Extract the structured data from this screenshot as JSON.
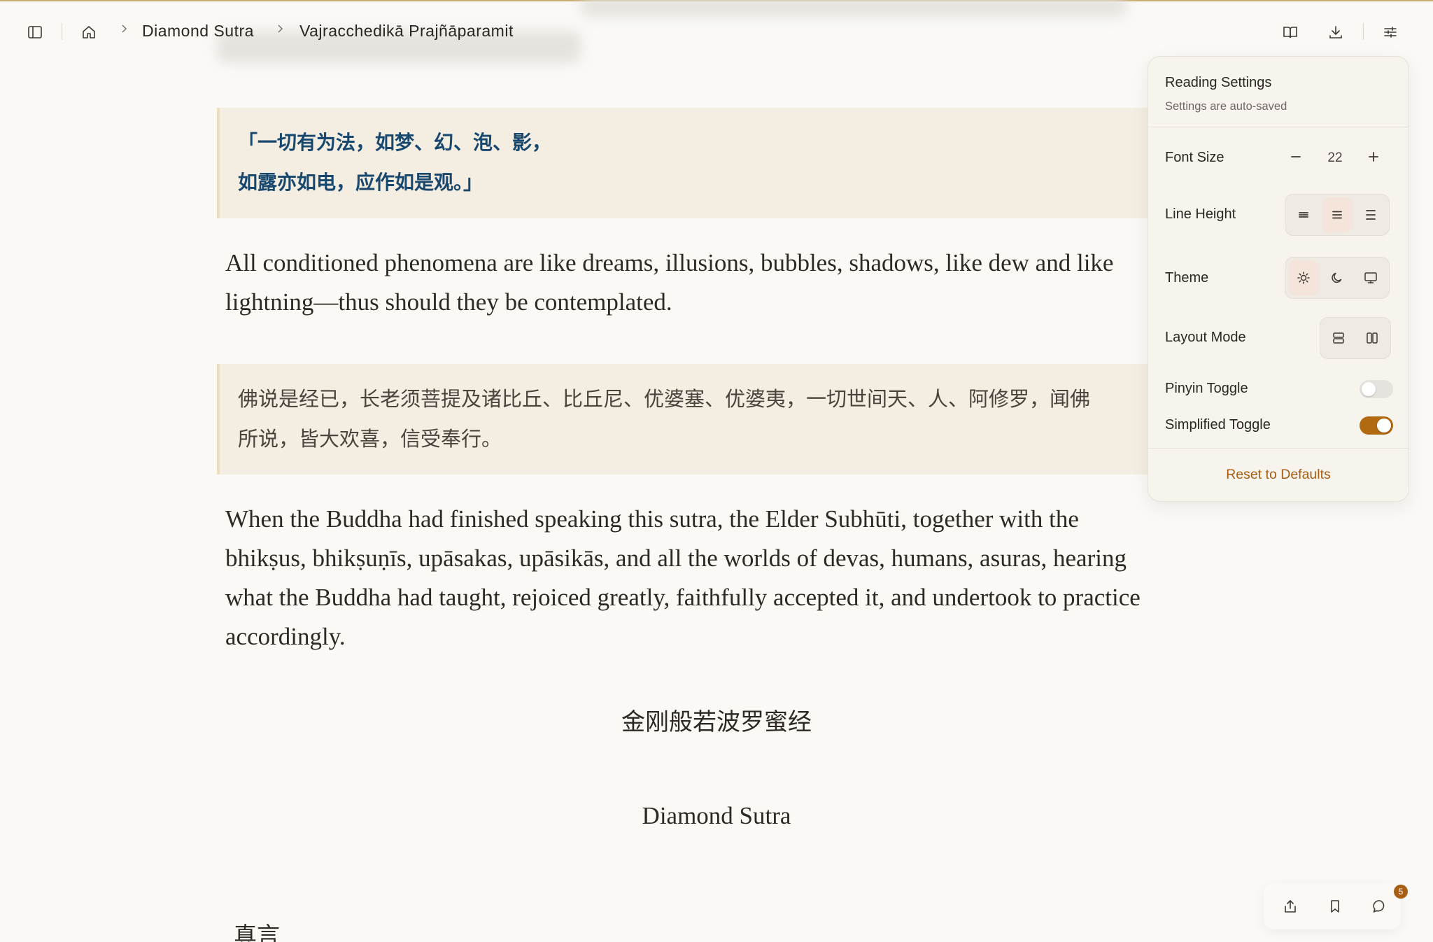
{
  "header": {
    "breadcrumb": [
      "Diamond Sutra",
      "Vajracchedikā Prajñāparamit"
    ]
  },
  "content": {
    "verse_lines": [
      "「一切有为法，如梦、幻、泡、影，",
      "如露亦如电，应作如是观。」"
    ],
    "verse_translation_lines": [
      "All conditioned phenomena are like dreams, illusions, bubbles, shadows, like dew and like",
      "lightning—thus should they be contemplated."
    ],
    "closing_cn_lines": [
      "佛说是经已，长老须菩提及诸比丘、比丘尼、优婆塞、优婆夷，一切世间天、人、阿修罗，闻佛",
      "所说，皆大欢喜，信受奉行。"
    ],
    "closing_en_lines": [
      "When the Buddha had finished speaking this sutra, the Elder Subhūti, together with the",
      "bhikṣus, bhikṣuṇīs, upāsakas, upāsikās, and all the worlds of devas, humans, asuras, hearing",
      "what the Buddha had taught, rejoiced greatly, faithfully accepted it, and undertook to practice",
      "accordingly."
    ],
    "title_cn": "金刚般若波罗蜜经",
    "title_en": "Diamond Sutra",
    "mantra_heading": "真言"
  },
  "settings": {
    "title": "Reading Settings",
    "subtitle": "Settings are auto-saved",
    "font_size": {
      "label": "Font Size",
      "value": "22"
    },
    "line_height": {
      "label": "Line Height",
      "options": [
        "compact-icon",
        "normal-icon",
        "relaxed-icon"
      ],
      "selected": "normal"
    },
    "theme": {
      "label": "Theme",
      "options": [
        "sun-icon",
        "moon-icon",
        "monitor-icon"
      ],
      "selected": "light"
    },
    "layout_mode": {
      "label": "Layout Mode",
      "options": [
        "rows-icon",
        "columns-icon"
      ]
    },
    "pinyin": {
      "label": "Pinyin Toggle",
      "on": false
    },
    "simplified": {
      "label": "Simplified Toggle",
      "on": true
    },
    "reset_label": "Reset to Defaults"
  },
  "bottom_toolbar": {
    "comment_count": "5"
  },
  "colors": {
    "accent": "#b26a12",
    "verse_text": "#19486e",
    "block_bg": "#f3ede2",
    "page_bg": "#faf9f6"
  }
}
